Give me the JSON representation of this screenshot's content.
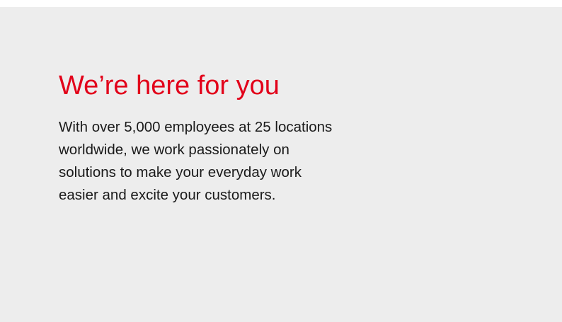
{
  "section": {
    "heading": "We’re here for you",
    "body_lines": [
      "With over 5,000 employees at 25 locations",
      "worldwide, we work passionately on",
      "solutions to make your everyday work",
      "easier and excite your customers."
    ]
  },
  "colors": {
    "heading": "#e2001a",
    "panel_background": "#ededed",
    "body_text": "#1a1a1a"
  }
}
